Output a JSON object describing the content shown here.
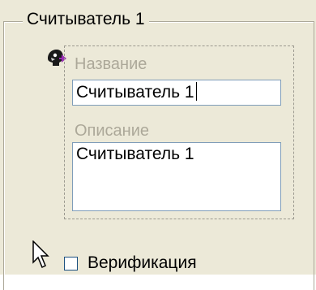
{
  "group": {
    "title": "Считыватель 1",
    "icon": "card-reader-icon"
  },
  "name_field": {
    "label": "Название",
    "value": "Считыватель 1"
  },
  "description_field": {
    "label": "Описание",
    "value": "Считыватель 1"
  },
  "verification": {
    "label": "Верификация",
    "checked": false
  },
  "colors": {
    "background": "#ece9d8",
    "disabled_text": "#aca899",
    "input_border": "#7f9db9"
  }
}
